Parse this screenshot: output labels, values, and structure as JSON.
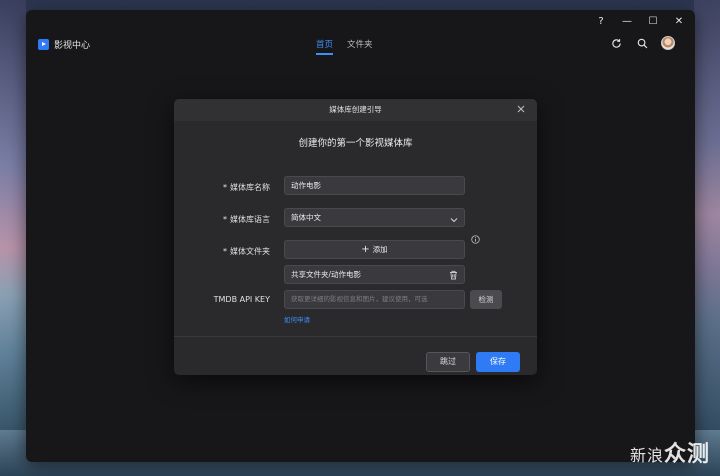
{
  "watermark": {
    "text_a": "新浪",
    "text_b": "众测"
  },
  "window": {
    "controls": {
      "help": "?",
      "minimize": "—",
      "maximize": "☐",
      "close": "✕"
    }
  },
  "header": {
    "app_title": "影视中心",
    "tabs": [
      {
        "label": "首页",
        "active": true
      },
      {
        "label": "文件夹",
        "active": false
      }
    ],
    "icons": [
      "refresh-icon",
      "search-icon",
      "avatar"
    ]
  },
  "dialog": {
    "title": "媒体库创建引导",
    "heading": "创建你的第一个影视媒体库",
    "fields": {
      "name": {
        "label": "媒体库名称",
        "required": true,
        "value": "动作电影"
      },
      "language": {
        "label": "媒体库语言",
        "required": true,
        "value": "简体中文"
      },
      "folder": {
        "label": "媒体文件夹",
        "required": true,
        "add_label": "添加",
        "path": "共享文件夹/动作电影"
      },
      "tmdb": {
        "label": "TMDB API KEY",
        "placeholder": "获取更详细的影视信息和图片，建议使用，可选",
        "detect_label": "检测",
        "help_link": "如何申请"
      }
    },
    "buttons": {
      "skip": "跳过",
      "save": "保存"
    }
  },
  "colors": {
    "accent": "#2f7bf6",
    "window_bg": "#17171a",
    "dialog_bg": "#2a2a2d"
  }
}
